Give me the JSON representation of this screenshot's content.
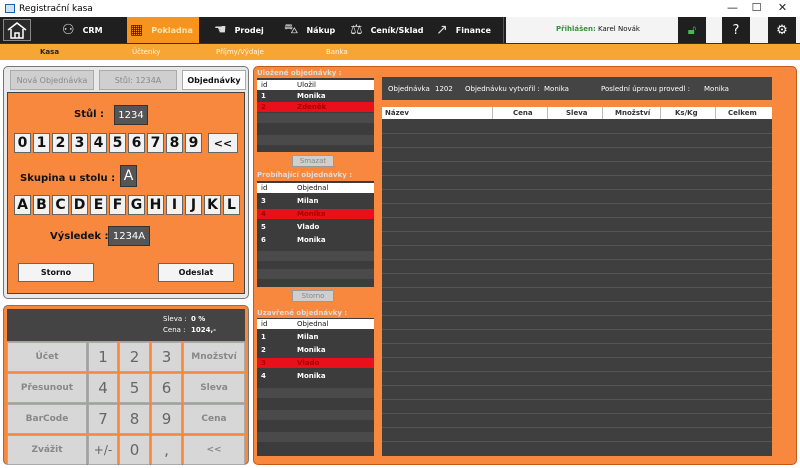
{
  "window": {
    "title": "Registrační kasa",
    "minimize": "—",
    "maximize": "☐",
    "close": "✕"
  },
  "menu": {
    "tabs": [
      {
        "label": "CRM",
        "icon": "people-icon"
      },
      {
        "label": "Pokladna",
        "icon": "cash-register-icon",
        "active": true
      },
      {
        "label": "Prodej",
        "icon": "hand-icon"
      },
      {
        "label": "Nákup",
        "icon": "cart-icon"
      },
      {
        "label": "Ceník/Sklad",
        "icon": "scale-icon"
      },
      {
        "label": "Finance",
        "icon": "chart-icon"
      }
    ],
    "logged_label": "Přihlášen:",
    "user": "Karel Novák"
  },
  "subtabs": [
    {
      "label": "Kasa",
      "active": true
    },
    {
      "label": "Účtenky"
    },
    {
      "label": "Příjmy/Výdaje"
    },
    {
      "label": "Banka"
    }
  ],
  "order_tabs": [
    "Nová Objednávka",
    "Stůl: 1234A",
    "Objednávky"
  ],
  "table_form": {
    "table_label": "Stůl :",
    "table_value": "1234",
    "digits": [
      "0",
      "1",
      "2",
      "3",
      "4",
      "5",
      "6",
      "7",
      "8",
      "9",
      "<<"
    ],
    "group_label": "Skupina u stolu :",
    "group_value": "A",
    "letters": [
      "A",
      "B",
      "C",
      "D",
      "E",
      "F",
      "G",
      "H",
      "I",
      "J",
      "K",
      "L"
    ],
    "result_label": "Výsledek :",
    "result_value": "1234A",
    "cancel": "Storno",
    "send": "Odeslat"
  },
  "pad": {
    "discount_label": "Sleva :",
    "discount_value": "0 %",
    "price_label": "Cena :",
    "price_value": "1024,-",
    "keys": [
      [
        "Účet",
        "1",
        "2",
        "3",
        "Množství"
      ],
      [
        "Přesunout",
        "4",
        "5",
        "6",
        "Sleva"
      ],
      [
        "BarCode",
        "7",
        "8",
        "9",
        "Cena"
      ],
      [
        "Zvážit",
        "+/-",
        "0",
        ",",
        "<<"
      ]
    ]
  },
  "saved_orders": {
    "title": "Uložené objednávky :",
    "headers": [
      "id",
      "Uložil"
    ],
    "rows": [
      [
        "1",
        "Monika"
      ],
      [
        "2",
        "Zdeněk"
      ]
    ],
    "delete": "Smazat"
  },
  "running_orders": {
    "title": "Probíhající objednávky :",
    "headers": [
      "id",
      "Objednal"
    ],
    "rows": [
      [
        "3",
        "Milan"
      ],
      [
        "4",
        "Monika"
      ],
      [
        "5",
        "Vlado"
      ],
      [
        "6",
        "Monika"
      ]
    ],
    "cancel": "Storno"
  },
  "closed_orders": {
    "title": "Uzavřené objednávky :",
    "headers": [
      "id",
      "Objednal"
    ],
    "rows": [
      [
        "1",
        "Milan"
      ],
      [
        "2",
        "Monika"
      ],
      [
        "3",
        "Vlado"
      ],
      [
        "4",
        "Monika"
      ]
    ]
  },
  "order_info": {
    "order_label": "Objednávka",
    "order_no": "1202",
    "created_label": "Objednávku vytvořil :",
    "created_by": "Monika",
    "last_edit_label": "Poslední úpravu provedl :",
    "last_edit_by": "Monika"
  },
  "items_table": {
    "headers": [
      "Název",
      "Cena",
      "Sleva",
      "Množství",
      "Ks/Kg",
      "Celkem"
    ]
  },
  "colors": {
    "accent": "#f7941d",
    "panel": "#f7883e",
    "dark": "#1f1f1f",
    "highlight": "#e8101a"
  }
}
